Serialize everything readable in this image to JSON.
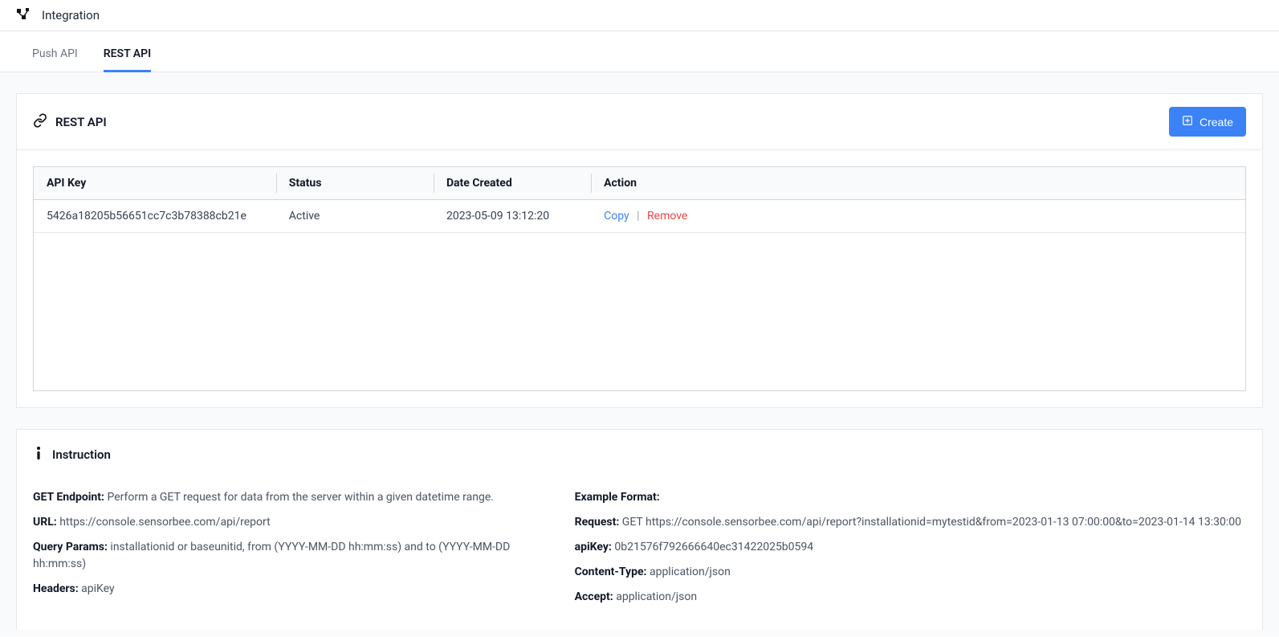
{
  "header": {
    "title": "Integration"
  },
  "tabs": [
    {
      "label": "Push API",
      "active": false
    },
    {
      "label": "REST API",
      "active": true
    }
  ],
  "rest_api_card": {
    "title": "REST API",
    "create_label": "Create",
    "columns": {
      "api_key": "API Key",
      "status": "Status",
      "date_created": "Date Created",
      "action": "Action"
    },
    "rows": [
      {
        "api_key": "5426a18205b56651cc7c3b78388cb21e",
        "status": "Active",
        "date_created": "2023-05-09 13:12:20",
        "copy_label": "Copy",
        "remove_label": "Remove"
      }
    ]
  },
  "instruction": {
    "title": "Instruction",
    "left": {
      "get_endpoint_label": "GET Endpoint:",
      "get_endpoint_text": "Perform a GET request for data from the server within a given datetime range.",
      "url_label": "URL:",
      "url_text": "https://console.sensorbee.com/api/report",
      "query_params_label": "Query Params:",
      "query_params_text": "installationid or baseunitid, from (YYYY-MM-DD hh:mm:ss) and to (YYYY-MM-DD hh:mm:ss)",
      "headers_label": "Headers:",
      "headers_text": "apiKey"
    },
    "right": {
      "example_format_label": "Example Format:",
      "request_label": "Request:",
      "request_text": "GET https://console.sensorbee.com/api/report?installationid=mytestid&from=2023-01-13 07:00:00&to=2023-01-14 13:30:00",
      "apikey_label": "apiKey:",
      "apikey_text": "0b21576f792666640ec31422025b0594",
      "contenttype_label": "Content-Type:",
      "contenttype_text": "application/json",
      "accept_label": "Accept:",
      "accept_text": "application/json"
    }
  }
}
